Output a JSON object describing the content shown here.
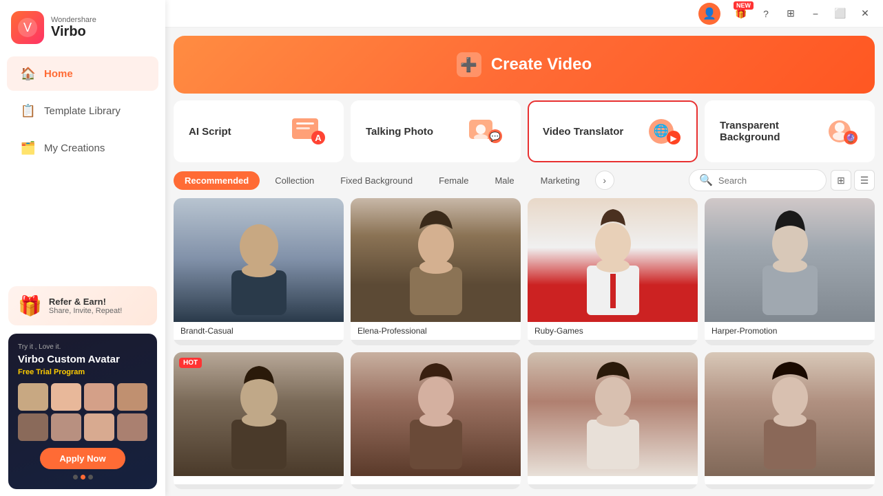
{
  "app": {
    "brand": "Wondershare",
    "name": "Virbo"
  },
  "titlebar": {
    "user_icon": "👤",
    "gift_icon": "🎁",
    "help_icon": "?",
    "grid_icon": "⊞",
    "minimize_icon": "−",
    "restore_icon": "⬜",
    "close_icon": "✕",
    "new_label": "NEW"
  },
  "sidebar": {
    "nav_items": [
      {
        "id": "home",
        "label": "Home",
        "icon": "🏠",
        "active": true
      },
      {
        "id": "template-library",
        "label": "Template Library",
        "icon": "📋",
        "active": false
      },
      {
        "id": "my-creations",
        "label": "My Creations",
        "icon": "🗂️",
        "active": false
      }
    ],
    "refer_banner": {
      "icon": "🎁",
      "title": "Refer & Earn!",
      "subtitle": "Share, Invite, Repeat!"
    },
    "custom_avatar_banner": {
      "tag": "Try it , Love it.",
      "title": "Virbo Custom Avatar",
      "subtitle": "Free Trial Program",
      "apply_label": "Apply Now"
    },
    "dots": [
      {
        "active": false
      },
      {
        "active": true
      },
      {
        "active": false
      }
    ]
  },
  "hero": {
    "icon": "➕",
    "title": "Create Video"
  },
  "feature_cards": [
    {
      "id": "ai-script",
      "label": "AI Script",
      "selected": false
    },
    {
      "id": "talking-photo",
      "label": "Talking Photo",
      "selected": false
    },
    {
      "id": "video-translator",
      "label": "Video Translator",
      "selected": true
    },
    {
      "id": "transparent-bg",
      "label": "Transparent Background",
      "selected": false
    }
  ],
  "filter_tabs": [
    {
      "id": "recommended",
      "label": "Recommended",
      "active": true
    },
    {
      "id": "collection",
      "label": "Collection",
      "active": false
    },
    {
      "id": "fixed-background",
      "label": "Fixed Background",
      "active": false
    },
    {
      "id": "female",
      "label": "Female",
      "active": false
    },
    {
      "id": "male",
      "label": "Male",
      "active": false
    },
    {
      "id": "marketing",
      "label": "Marketing",
      "active": false
    }
  ],
  "search": {
    "placeholder": "Search",
    "value": ""
  },
  "avatars": [
    {
      "id": "brandt",
      "name": "Brandt-Casual",
      "hot": false,
      "color_class": "av-brandt"
    },
    {
      "id": "elena",
      "name": "Elena-Professional",
      "hot": false,
      "color_class": "av-elena"
    },
    {
      "id": "ruby",
      "name": "Ruby-Games",
      "hot": false,
      "color_class": "av-ruby"
    },
    {
      "id": "harper",
      "name": "Harper-Promotion",
      "hot": false,
      "color_class": "av-harper"
    },
    {
      "id": "hot1",
      "name": "",
      "hot": true,
      "color_class": "av-hot1"
    },
    {
      "id": "hot2",
      "name": "",
      "hot": false,
      "color_class": "av-hot2"
    },
    {
      "id": "hot3",
      "name": "",
      "hot": false,
      "color_class": "av-hot3"
    },
    {
      "id": "hot4",
      "name": "",
      "hot": false,
      "color_class": "av-hot4"
    }
  ],
  "hot_badge_label": "HOT"
}
